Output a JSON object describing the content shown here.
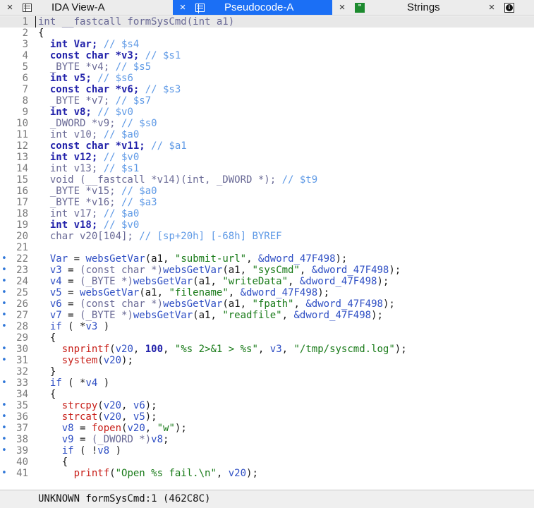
{
  "tabs": [
    {
      "label": "IDA View-A",
      "icon": "list-view-icon",
      "close": "×",
      "active": false
    },
    {
      "label": "Pseudocode-A",
      "icon": "list-view-icon",
      "close": "×",
      "active": true
    },
    {
      "label": "Strings",
      "icon": "strings-icon",
      "icon_text": "\"",
      "close": "×",
      "active": false
    },
    {
      "label": "",
      "icon": "info-icon",
      "icon_text": "i",
      "close": "×",
      "active": false
    }
  ],
  "colors": {
    "active_tab": "#1b6ff5",
    "keyword": "#2222aa",
    "comment": "#5f9ae6",
    "string": "#187a18",
    "function": "#c8201a",
    "breakpoint_dot": "#2f76d8"
  },
  "breakpoint_marker": "•",
  "code_lines": [
    {
      "n": "1",
      "dot": false,
      "segs": [
        [
          "t",
          "int __fastcall formSysCmd(int a1)"
        ]
      ]
    },
    {
      "n": "2",
      "dot": false,
      "segs": [
        [
          "p",
          "{"
        ]
      ]
    },
    {
      "n": "3",
      "dot": false,
      "segs": [
        [
          "k",
          "  int Var; "
        ],
        [
          "c",
          "// $s4"
        ]
      ]
    },
    {
      "n": "4",
      "dot": false,
      "segs": [
        [
          "k",
          "  const char *v3; "
        ],
        [
          "c",
          "// $s1"
        ]
      ]
    },
    {
      "n": "5",
      "dot": false,
      "segs": [
        [
          "t",
          "  _BYTE *v4; "
        ],
        [
          "c",
          "// $s5"
        ]
      ]
    },
    {
      "n": "6",
      "dot": false,
      "segs": [
        [
          "k",
          "  int v5; "
        ],
        [
          "c",
          "// $s6"
        ]
      ]
    },
    {
      "n": "7",
      "dot": false,
      "segs": [
        [
          "k",
          "  const char *v6; "
        ],
        [
          "c",
          "// $s3"
        ]
      ]
    },
    {
      "n": "8",
      "dot": false,
      "segs": [
        [
          "t",
          "  _BYTE *v7; "
        ],
        [
          "c",
          "// $s7"
        ]
      ]
    },
    {
      "n": "9",
      "dot": false,
      "segs": [
        [
          "k",
          "  int v8; "
        ],
        [
          "c",
          "// $v0"
        ]
      ]
    },
    {
      "n": "10",
      "dot": false,
      "segs": [
        [
          "t",
          "  _DWORD *v9; "
        ],
        [
          "c",
          "// $s0"
        ]
      ]
    },
    {
      "n": "11",
      "dot": false,
      "segs": [
        [
          "t",
          "  int v10; "
        ],
        [
          "c",
          "// $a0"
        ]
      ]
    },
    {
      "n": "12",
      "dot": false,
      "segs": [
        [
          "k",
          "  const char *v11; "
        ],
        [
          "c",
          "// $a1"
        ]
      ]
    },
    {
      "n": "13",
      "dot": false,
      "segs": [
        [
          "k",
          "  int v12; "
        ],
        [
          "c",
          "// $v0"
        ]
      ]
    },
    {
      "n": "14",
      "dot": false,
      "segs": [
        [
          "t",
          "  int v13; "
        ],
        [
          "c",
          "// $s1"
        ]
      ]
    },
    {
      "n": "15",
      "dot": false,
      "segs": [
        [
          "t",
          "  void (__fastcall *v14)(int, _DWORD *); "
        ],
        [
          "c",
          "// $t9"
        ]
      ]
    },
    {
      "n": "16",
      "dot": false,
      "segs": [
        [
          "t",
          "  _BYTE *v15; "
        ],
        [
          "c",
          "// $a0"
        ]
      ]
    },
    {
      "n": "17",
      "dot": false,
      "segs": [
        [
          "t",
          "  _BYTE *v16; "
        ],
        [
          "c",
          "// $a3"
        ]
      ]
    },
    {
      "n": "18",
      "dot": false,
      "segs": [
        [
          "t",
          "  int v17; "
        ],
        [
          "c",
          "// $a0"
        ]
      ]
    },
    {
      "n": "19",
      "dot": false,
      "segs": [
        [
          "k",
          "  int v18; "
        ],
        [
          "c",
          "// $v0"
        ]
      ]
    },
    {
      "n": "20",
      "dot": false,
      "segs": [
        [
          "t",
          "  char v20[104]; "
        ],
        [
          "c",
          "// [sp+20h] [-68h] BYREF"
        ]
      ]
    },
    {
      "n": "21",
      "dot": false,
      "segs": [
        [
          "p",
          ""
        ]
      ]
    },
    {
      "n": "22",
      "dot": true,
      "segs": [
        [
          "v",
          "  Var"
        ],
        [
          "p",
          " = "
        ],
        [
          "v",
          "websGetVar"
        ],
        [
          "p",
          "(a1, "
        ],
        [
          "s",
          "\"submit-url\""
        ],
        [
          "p",
          ", "
        ],
        [
          "v",
          "&dword_47F498"
        ],
        [
          "p",
          ");"
        ]
      ]
    },
    {
      "n": "23",
      "dot": true,
      "segs": [
        [
          "v",
          "  v3"
        ],
        [
          "p",
          " = "
        ],
        [
          "t",
          "(const char *)"
        ],
        [
          "v",
          "websGetVar"
        ],
        [
          "p",
          "(a1, "
        ],
        [
          "s",
          "\"sysCmd\""
        ],
        [
          "p",
          ", "
        ],
        [
          "v",
          "&dword_47F498"
        ],
        [
          "p",
          ");"
        ]
      ]
    },
    {
      "n": "24",
      "dot": true,
      "segs": [
        [
          "v",
          "  v4"
        ],
        [
          "p",
          " = "
        ],
        [
          "t",
          "(_BYTE *)"
        ],
        [
          "v",
          "websGetVar"
        ],
        [
          "p",
          "(a1, "
        ],
        [
          "s",
          "\"writeData\""
        ],
        [
          "p",
          ", "
        ],
        [
          "v",
          "&dword_47F498"
        ],
        [
          "p",
          ");"
        ]
      ]
    },
    {
      "n": "25",
      "dot": true,
      "segs": [
        [
          "v",
          "  v5"
        ],
        [
          "p",
          " = "
        ],
        [
          "v",
          "websGetVar"
        ],
        [
          "p",
          "(a1, "
        ],
        [
          "s",
          "\"filename\""
        ],
        [
          "p",
          ", "
        ],
        [
          "v",
          "&dword_47F498"
        ],
        [
          "p",
          ");"
        ]
      ]
    },
    {
      "n": "26",
      "dot": true,
      "segs": [
        [
          "v",
          "  v6"
        ],
        [
          "p",
          " = "
        ],
        [
          "t",
          "(const char *)"
        ],
        [
          "v",
          "websGetVar"
        ],
        [
          "p",
          "(a1, "
        ],
        [
          "s",
          "\"fpath\""
        ],
        [
          "p",
          ", "
        ],
        [
          "v",
          "&dword_47F498"
        ],
        [
          "p",
          ");"
        ]
      ]
    },
    {
      "n": "27",
      "dot": true,
      "segs": [
        [
          "v",
          "  v7"
        ],
        [
          "p",
          " = "
        ],
        [
          "t",
          "(_BYTE *)"
        ],
        [
          "v",
          "websGetVar"
        ],
        [
          "p",
          "(a1, "
        ],
        [
          "s",
          "\"readfile\""
        ],
        [
          "p",
          ", "
        ],
        [
          "v",
          "&dword_47F498"
        ],
        [
          "p",
          ");"
        ]
      ]
    },
    {
      "n": "28",
      "dot": true,
      "segs": [
        [
          "v",
          "  if"
        ],
        [
          "p",
          " ( *"
        ],
        [
          "v",
          "v3"
        ],
        [
          "p",
          " )"
        ]
      ]
    },
    {
      "n": "29",
      "dot": false,
      "segs": [
        [
          "p",
          "  {"
        ]
      ]
    },
    {
      "n": "30",
      "dot": true,
      "segs": [
        [
          "f",
          "    snprintf"
        ],
        [
          "p",
          "("
        ],
        [
          "v",
          "v20"
        ],
        [
          "p",
          ", "
        ],
        [
          "n",
          "100"
        ],
        [
          "p",
          ", "
        ],
        [
          "s",
          "\"%s 2>&1 > %s\""
        ],
        [
          "p",
          ", "
        ],
        [
          "v",
          "v3"
        ],
        [
          "p",
          ", "
        ],
        [
          "s",
          "\"/tmp/syscmd.log\""
        ],
        [
          "p",
          ");"
        ]
      ]
    },
    {
      "n": "31",
      "dot": true,
      "segs": [
        [
          "f",
          "    system"
        ],
        [
          "p",
          "("
        ],
        [
          "v",
          "v20"
        ],
        [
          "p",
          ");"
        ]
      ]
    },
    {
      "n": "32",
      "dot": false,
      "segs": [
        [
          "p",
          "  }"
        ]
      ]
    },
    {
      "n": "33",
      "dot": true,
      "segs": [
        [
          "v",
          "  if"
        ],
        [
          "p",
          " ( *"
        ],
        [
          "v",
          "v4"
        ],
        [
          "p",
          " )"
        ]
      ]
    },
    {
      "n": "34",
      "dot": false,
      "segs": [
        [
          "p",
          "  {"
        ]
      ]
    },
    {
      "n": "35",
      "dot": true,
      "segs": [
        [
          "f",
          "    strcpy"
        ],
        [
          "p",
          "("
        ],
        [
          "v",
          "v20"
        ],
        [
          "p",
          ", "
        ],
        [
          "v",
          "v6"
        ],
        [
          "p",
          ");"
        ]
      ]
    },
    {
      "n": "36",
      "dot": true,
      "segs": [
        [
          "f",
          "    strcat"
        ],
        [
          "p",
          "("
        ],
        [
          "v",
          "v20"
        ],
        [
          "p",
          ", "
        ],
        [
          "v",
          "v5"
        ],
        [
          "p",
          ");"
        ]
      ]
    },
    {
      "n": "37",
      "dot": true,
      "segs": [
        [
          "v",
          "    v8"
        ],
        [
          "p",
          " = "
        ],
        [
          "f",
          "fopen"
        ],
        [
          "p",
          "("
        ],
        [
          "v",
          "v20"
        ],
        [
          "p",
          ", "
        ],
        [
          "s",
          "\"w\""
        ],
        [
          "p",
          ");"
        ]
      ]
    },
    {
      "n": "38",
      "dot": true,
      "segs": [
        [
          "v",
          "    v9"
        ],
        [
          "p",
          " = "
        ],
        [
          "t",
          "(_DWORD *)"
        ],
        [
          "v",
          "v8"
        ],
        [
          "p",
          ";"
        ]
      ]
    },
    {
      "n": "39",
      "dot": true,
      "segs": [
        [
          "v",
          "    if"
        ],
        [
          "p",
          " ( !"
        ],
        [
          "v",
          "v8"
        ],
        [
          "p",
          " )"
        ]
      ]
    },
    {
      "n": "40",
      "dot": false,
      "segs": [
        [
          "p",
          "    {"
        ]
      ]
    },
    {
      "n": "41",
      "dot": true,
      "segs": [
        [
          "f",
          "      printf"
        ],
        [
          "p",
          "("
        ],
        [
          "s",
          "\"Open %s fail.\\n\""
        ],
        [
          "p",
          ", "
        ],
        [
          "v",
          "v20"
        ],
        [
          "p",
          ");"
        ]
      ]
    }
  ],
  "status": {
    "text": "UNKNOWN formSysCmd:1 (462C8C)"
  }
}
